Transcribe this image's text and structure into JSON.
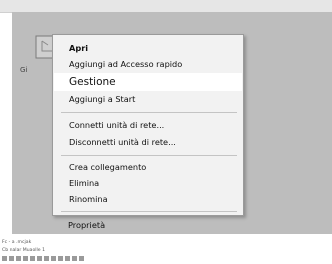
{
  "desktop": {
    "icon_name": "drive-icon",
    "icon_label": "Gi"
  },
  "context_menu": {
    "items": [
      {
        "label": "Apri",
        "bold": true
      },
      {
        "label": "Aggiungi ad Accesso rapido"
      },
      {
        "label": "Gestione",
        "highlighted": true
      },
      {
        "label": "Aggiungi a Start"
      },
      {
        "label": "Connetti unità di rete..."
      },
      {
        "label": "Disconnetti unità di rete..."
      },
      {
        "label": "Crea collegamento"
      },
      {
        "label": "Elimina"
      },
      {
        "label": "Rinomina"
      },
      {
        "label": "Proprietà"
      }
    ]
  },
  "status_bar": {
    "line1": "Fc - a .mcjak",
    "line2": "Cb   nalar Muaolle 1",
    "toolbar_icons": [
      "tool-icon-1",
      "tool-icon-2",
      "tool-icon-3",
      "tool-icon-4",
      "tool-icon-5",
      "tool-icon-6",
      "tool-icon-7",
      "tool-icon-8",
      "tool-icon-9",
      "tool-icon-10",
      "tool-icon-11",
      "tool-icon-12"
    ]
  },
  "colors": {
    "desktop_bg": "#bdbdbd",
    "menu_bg": "#f2f2f2",
    "highlight_bg": "#ffffff"
  }
}
